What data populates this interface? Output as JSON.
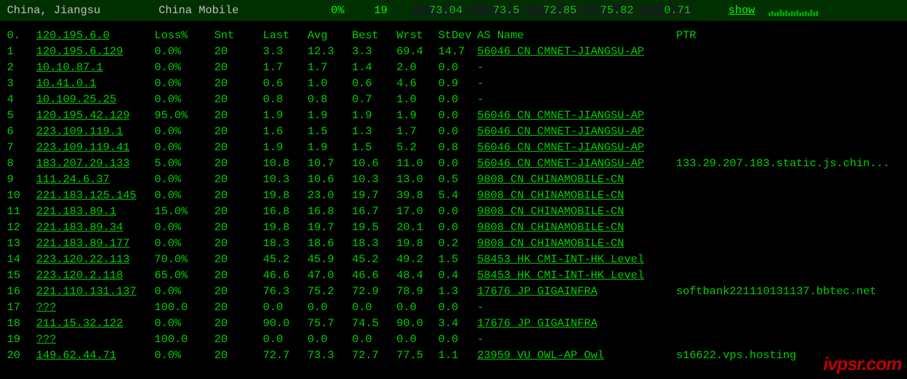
{
  "header": {
    "location": "China, Jiangsu",
    "isp": "China Mobile",
    "pct": "0%",
    "count": "19",
    "stats": [
      "73.04",
      "73.5",
      "72.85",
      "75.82",
      "0.71"
    ],
    "show": "show"
  },
  "columns": {
    "idx": "0.",
    "ip": "120.195.6.0",
    "loss": "Loss%",
    "snt": "Snt",
    "last": "Last",
    "avg": "Avg",
    "best": "Best",
    "wrst": "Wrst",
    "stdev": "StDev",
    "as": "AS Name",
    "ptr": "PTR"
  },
  "rows": [
    {
      "idx": "1",
      "ip": "120.195.6.129",
      "loss": "0.0%",
      "snt": "20",
      "last": "3.3",
      "avg": "12.3",
      "best": "3.3",
      "wrst": "69.4",
      "stdev": "14.7",
      "as": "56046 CN CMNET-JIANGSU-AP",
      "ptr": ""
    },
    {
      "idx": "2",
      "ip": "10.10.87.1",
      "loss": "0.0%",
      "snt": "20",
      "last": "1.7",
      "avg": "1.7",
      "best": "1.4",
      "wrst": "2.0",
      "stdev": "0.0",
      "as": "-",
      "ptr": ""
    },
    {
      "idx": "3",
      "ip": "10.41.0.1",
      "loss": "0.0%",
      "snt": "20",
      "last": "0.6",
      "avg": "1.0",
      "best": "0.6",
      "wrst": "4.6",
      "stdev": "0.9",
      "as": "-",
      "ptr": ""
    },
    {
      "idx": "4",
      "ip": "10.109.25.25",
      "loss": "0.0%",
      "snt": "20",
      "last": "0.8",
      "avg": "0.8",
      "best": "0.7",
      "wrst": "1.0",
      "stdev": "0.0",
      "as": "-",
      "ptr": ""
    },
    {
      "idx": "5",
      "ip": "120.195.42.129",
      "loss": "95.0%",
      "snt": "20",
      "last": "1.9",
      "avg": "1.9",
      "best": "1.9",
      "wrst": "1.9",
      "stdev": "0.0",
      "as": "56046 CN CMNET-JIANGSU-AP",
      "ptr": ""
    },
    {
      "idx": "6",
      "ip": "223.109.119.1",
      "loss": "0.0%",
      "snt": "20",
      "last": "1.6",
      "avg": "1.5",
      "best": "1.3",
      "wrst": "1.7",
      "stdev": "0.0",
      "as": "56046 CN CMNET-JIANGSU-AP",
      "ptr": ""
    },
    {
      "idx": "7",
      "ip": "223.109.119.41",
      "loss": "0.0%",
      "snt": "20",
      "last": "1.9",
      "avg": "1.9",
      "best": "1.5",
      "wrst": "5.2",
      "stdev": "0.8",
      "as": "56046 CN CMNET-JIANGSU-AP",
      "ptr": ""
    },
    {
      "idx": "8",
      "ip": "183.207.29.133",
      "loss": "5.0%",
      "snt": "20",
      "last": "10.8",
      "avg": "10.7",
      "best": "10.6",
      "wrst": "11.0",
      "stdev": "0.0",
      "as": "56046 CN CMNET-JIANGSU-AP",
      "ptr": "133.29.207.183.static.js.chin..."
    },
    {
      "idx": "9",
      "ip": "111.24.6.37",
      "loss": "0.0%",
      "snt": "20",
      "last": "10.3",
      "avg": "10.6",
      "best": "10.3",
      "wrst": "13.0",
      "stdev": "0.5",
      "as": "9808  CN CHINAMOBILE-CN",
      "ptr": ""
    },
    {
      "idx": "10",
      "ip": "221.183.125.145",
      "loss": "0.0%",
      "snt": "20",
      "last": "19.8",
      "avg": "23.0",
      "best": "19.7",
      "wrst": "39.8",
      "stdev": "5.4",
      "as": "9808  CN CHINAMOBILE-CN",
      "ptr": ""
    },
    {
      "idx": "11",
      "ip": "221.183.89.1",
      "loss": "15.0%",
      "snt": "20",
      "last": "16.8",
      "avg": "16.8",
      "best": "16.7",
      "wrst": "17.0",
      "stdev": "0.0",
      "as": "9808  CN CHINAMOBILE-CN",
      "ptr": ""
    },
    {
      "idx": "12",
      "ip": "221.183.89.34",
      "loss": "0.0%",
      "snt": "20",
      "last": "19.8",
      "avg": "19.7",
      "best": "19.5",
      "wrst": "20.1",
      "stdev": "0.0",
      "as": "9808  CN CHINAMOBILE-CN",
      "ptr": ""
    },
    {
      "idx": "13",
      "ip": "221.183.89.177",
      "loss": "0.0%",
      "snt": "20",
      "last": "18.3",
      "avg": "18.6",
      "best": "18.3",
      "wrst": "19.8",
      "stdev": "0.2",
      "as": "9808  CN CHINAMOBILE-CN",
      "ptr": ""
    },
    {
      "idx": "14",
      "ip": "223.120.22.113",
      "loss": "70.0%",
      "snt": "20",
      "last": "45.2",
      "avg": "45.9",
      "best": "45.2",
      "wrst": "49.2",
      "stdev": "1.5",
      "as": "58453 HK CMI-INT-HK Level",
      "ptr": ""
    },
    {
      "idx": "15",
      "ip": "223.120.2.118",
      "loss": "65.0%",
      "snt": "20",
      "last": "46.6",
      "avg": "47.0",
      "best": "46.6",
      "wrst": "48.4",
      "stdev": "0.4",
      "as": "58453 HK CMI-INT-HK Level",
      "ptr": ""
    },
    {
      "idx": "16",
      "ip": "221.110.131.137",
      "loss": "0.0%",
      "snt": "20",
      "last": "76.3",
      "avg": "75.2",
      "best": "72.9",
      "wrst": "78.9",
      "stdev": "1.3",
      "as": "17676 JP GIGAINFRA",
      "ptr": "softbank221110131137.bbtec.net"
    },
    {
      "idx": "17",
      "ip": "???",
      "loss": "100.0",
      "snt": "20",
      "last": "0.0",
      "avg": "0.0",
      "best": "0.0",
      "wrst": "0.0",
      "stdev": "0.0",
      "as": "-",
      "ptr": ""
    },
    {
      "idx": "18",
      "ip": "211.15.32.122",
      "loss": "0.0%",
      "snt": "20",
      "last": "90.0",
      "avg": "75.7",
      "best": "74.5",
      "wrst": "90.0",
      "stdev": "3.4",
      "as": "17676 JP GIGAINFRA",
      "ptr": ""
    },
    {
      "idx": "19",
      "ip": "???",
      "loss": "100.0",
      "snt": "20",
      "last": "0.0",
      "avg": "0.0",
      "best": "0.0",
      "wrst": "0.0",
      "stdev": "0.0",
      "as": "-",
      "ptr": ""
    },
    {
      "idx": "20",
      "ip": "149.62.44.71",
      "loss": "0.0%",
      "snt": "20",
      "last": "72.7",
      "avg": "73.3",
      "best": "72.7",
      "wrst": "77.5",
      "stdev": "1.1",
      "as": "23959 VU OWL-AP Owl",
      "ptr": "s16622.vps.hosting"
    }
  ],
  "watermark": "ivpsr.com"
}
